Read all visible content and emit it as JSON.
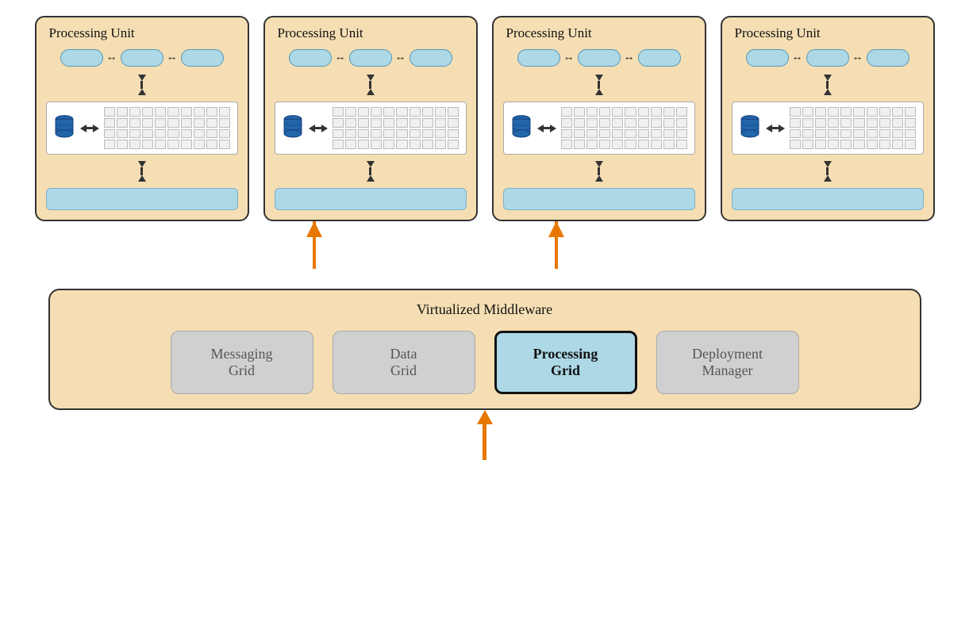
{
  "processing_units": [
    {
      "label": "Processing Unit"
    },
    {
      "label": "Processing Unit"
    },
    {
      "label": "Processing Unit"
    },
    {
      "label": "Processing Unit"
    }
  ],
  "middleware": {
    "label": "Virtualized Middleware",
    "components": [
      {
        "label": "Messaging\nGrid",
        "active": false
      },
      {
        "label": "Data\nGrid",
        "active": false
      },
      {
        "label": "Processing\nGrid",
        "active": true
      },
      {
        "label": "Deployment\nManager",
        "active": false
      }
    ]
  },
  "arrow_color": "#e87700",
  "inner_arrow_color": "#333333"
}
